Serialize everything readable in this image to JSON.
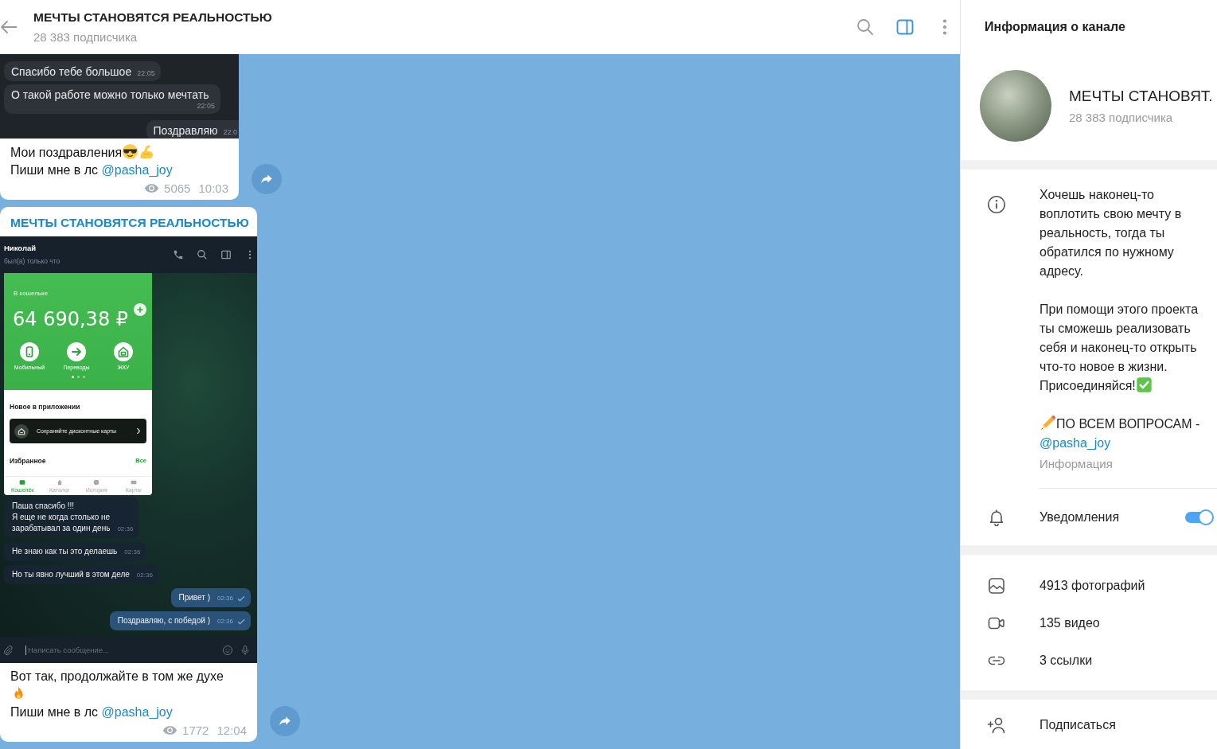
{
  "header": {
    "title": "МЕЧТЫ СТАНОВЯТСЯ РЕАЛЬНОСТЬЮ",
    "subtitle": "28 383 подписчика",
    "info_panel_toggle_on": true
  },
  "messages": [
    {
      "photo": {
        "kind": "chat_fragment",
        "bubbles": [
          {
            "text": "Спасибо тебе большое",
            "time": "22:05",
            "outgoing": false
          },
          {
            "text": "О такой работе можно только мечтать",
            "time": "22:05",
            "outgoing": false
          },
          {
            "text": "Поздравляю",
            "time": "22:0",
            "outgoing": true
          }
        ]
      },
      "caption": [
        [
          {
            "kind": "text",
            "text": "Мои поздравления"
          },
          {
            "kind": "cool_emoji"
          },
          {
            "kind": "muscle_emoji"
          }
        ],
        [
          {
            "kind": "text",
            "text": "Пиши мне в лс"
          },
          {
            "kind": "link",
            "text": "@pasha_joy"
          }
        ]
      ],
      "views": "5065",
      "time": "10:03"
    },
    {
      "sender": "МЕЧТЫ СТАНОВЯТСЯ РЕАЛЬНОСТЬЮ",
      "photo": {
        "kind": "phone_screenshot",
        "chat_title": "Николай",
        "chat_status": "был(а) только что",
        "wallet": {
          "label": "В кошельке",
          "amount": "64 690,38 ₽",
          "actions": [
            {
              "kind": "mobile",
              "label": "Мобильный"
            },
            {
              "kind": "transfer",
              "label": "Переводы"
            },
            {
              "kind": "utilities",
              "label": "ЖКУ"
            }
          ],
          "pages": [
            {
              "selected": true
            },
            {
              "selected": false
            },
            {
              "selected": false
            }
          ],
          "news_title": "Новое в приложении",
          "promo": "Сохраняйте дисконтные карты",
          "favorites_title": "Избранное",
          "favorites_link": "Все",
          "tabs": [
            {
              "kind": "wallet",
              "label": "Кошелёк",
              "selected": true
            },
            {
              "kind": "catalog",
              "label": "Каталог",
              "selected": false
            },
            {
              "kind": "history",
              "label": "История",
              "selected": false
            },
            {
              "kind": "cards",
              "label": "Карты",
              "selected": false
            }
          ]
        },
        "bubbles": [
          {
            "text": "Паша спасибо !!!\nЯ еще не когда столько не\nзарабатывал за один день",
            "time": "02:36",
            "outgoing": false
          },
          {
            "text": "Не знаю как ты это делаешь",
            "time": "02:36",
            "outgoing": false
          },
          {
            "text": "Но ты явно лучший в этом деле",
            "time": "02:36",
            "outgoing": false
          },
          {
            "text": "Привет )",
            "time": "02:36",
            "outgoing": true
          },
          {
            "text": "Поздравляю, с победой )",
            "time": "02:36",
            "outgoing": true
          }
        ],
        "input_placeholder": "Написать сообщение..."
      },
      "caption": [
        [
          {
            "kind": "text",
            "text": "Вот так, продолжайте в том же духе"
          }
        ],
        [
          {
            "kind": "fire_emoji"
          }
        ],
        [
          {
            "kind": "text",
            "text": "Пиши мне в лс"
          },
          {
            "kind": "link",
            "text": "@pasha_joy"
          }
        ]
      ],
      "views": "1772",
      "time": "12:04"
    }
  ],
  "info_panel": {
    "title": "Информация о канале",
    "channel_name": "МЕЧТЫ СТАНОВЯТ.",
    "subscribers": "28 383 подписчика",
    "description": [
      [
        {
          "kind": "text",
          "text": "Хочешь наконец-то воплотить свою мечту в реальность, тогда ты обратился по нужному адресу."
        }
      ],
      [
        {
          "kind": "text",
          "text": "При помощи этого проекта ты сможешь реализовать себя и наконец-то открыть что-то новое в жизни. Присоединяйся!"
        },
        {
          "kind": "check_emoji"
        }
      ],
      [
        {
          "kind": "pencil_emoji"
        },
        {
          "kind": "text",
          "text": "ПО ВСЕМ ВОПРОСАМ -"
        },
        {
          "kind": "link",
          "text": "@pasha_joy"
        }
      ]
    ],
    "description_label": "Информация",
    "notifications": {
      "label": "Уведомления",
      "on": true
    },
    "media": [
      {
        "kind": "photos",
        "label": "4913 фотографий"
      },
      {
        "kind": "videos",
        "label": "135 видео"
      },
      {
        "kind": "links",
        "label": "3 ссылки"
      }
    ],
    "subscribe": {
      "label": "Подписаться"
    }
  }
}
